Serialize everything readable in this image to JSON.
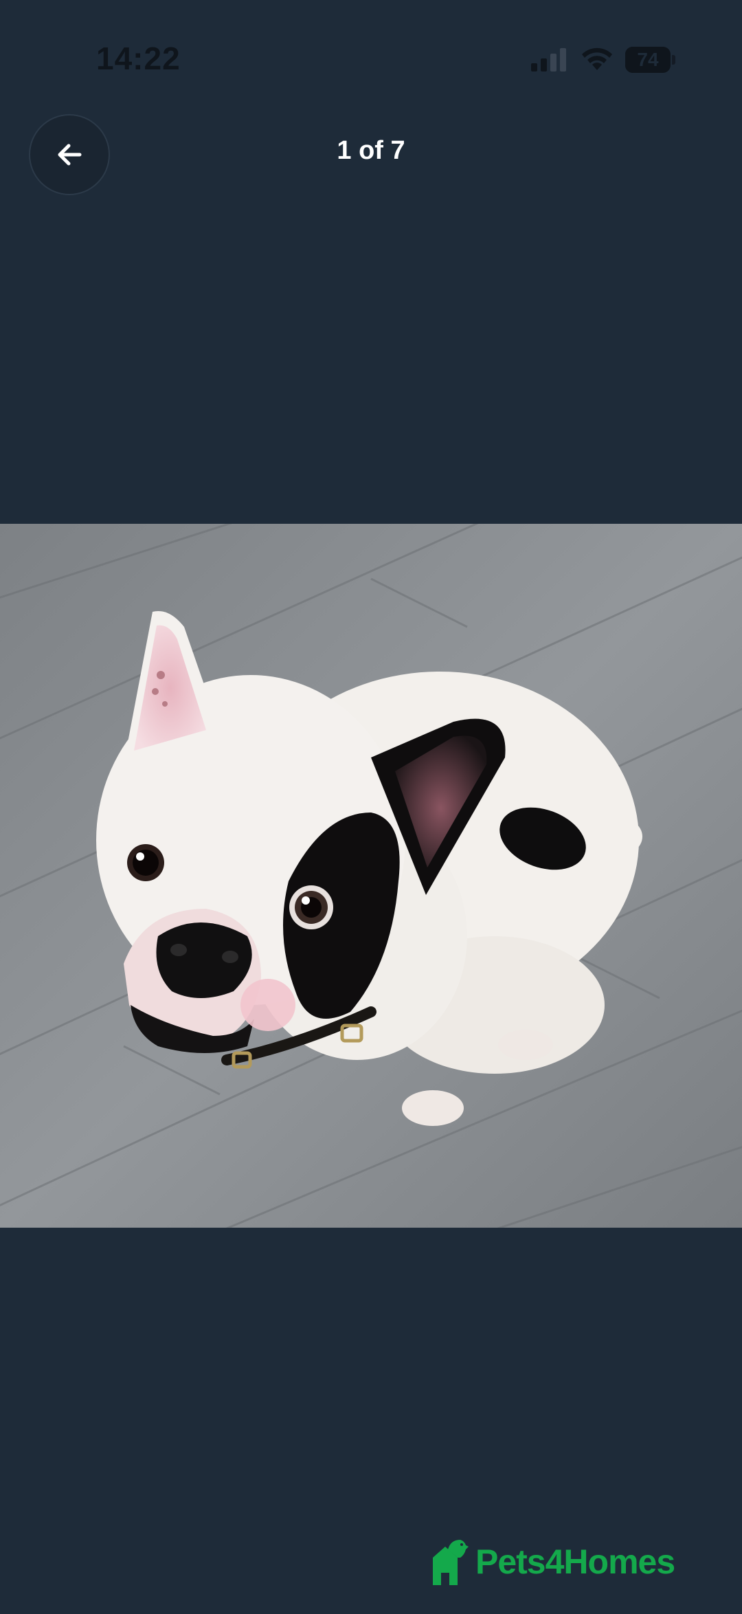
{
  "status_bar": {
    "time": "14:22",
    "battery_level": "74",
    "icons": [
      "cellular-signal-icon",
      "wifi-icon",
      "battery-icon"
    ]
  },
  "header": {
    "back_icon": "arrow-left-icon",
    "counter": "1 of 7"
  },
  "gallery": {
    "current_index": 1,
    "total": 7
  },
  "branding": {
    "logo_text": "Pets4Homes",
    "brand_color": "#14a94b"
  },
  "colors": {
    "background": "#1e2b39"
  }
}
